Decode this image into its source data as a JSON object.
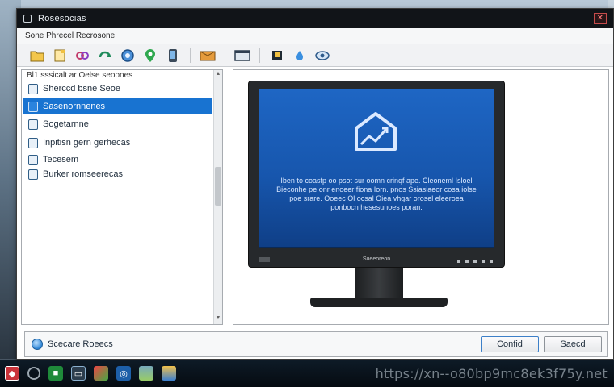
{
  "window": {
    "title": "Rosesocias",
    "close_glyph": "✕"
  },
  "menubar": {
    "label": "Sone Phrecel Recrosone"
  },
  "toolbar": {
    "icons": [
      "folder-icon",
      "document-icon",
      "link-icon",
      "refresh-icon",
      "globe-icon",
      "location-pin-icon",
      "phone-icon",
      "package-icon",
      "window-icon",
      "cube-icon",
      "droplet-icon",
      "eye-icon"
    ]
  },
  "left_pane": {
    "header": "Bl1 sssicalt ar Oelse seoones",
    "items": [
      {
        "label": "Sherccd bsne Seoe"
      },
      {
        "label": "Sasenornnenes"
      },
      {
        "label": "Sogetarnne"
      },
      {
        "label": "Inpitisn gern gerhecas"
      },
      {
        "label": "Tecesem"
      },
      {
        "label": "Burker romseerecas"
      }
    ],
    "selected_index": 1
  },
  "monitor": {
    "screen_text": "Iben to coasfp oo psot sur oomn crinqf ape. Cleoneml Isloel Bieconhe pe onr enoeer fiona Iorn. pnos Ssiasiaeor cosa iolse poe srare. Ooeec Ol ocsal Oiea vhgar orosel eleeroea ponbocn hesesunoes poran.",
    "brand": "Sueeoreon"
  },
  "footer": {
    "status_text": "Scecare Roeecs",
    "ok_label": "Confid",
    "cancel_label": "Saecd"
  },
  "taskbar": {
    "items": [
      "shield-icon",
      "circle-icon",
      "green-app-icon",
      "monitor-app-icon",
      "photos-icon",
      "network-icon",
      "gallery-icon",
      "folder-app-icon"
    ]
  },
  "watermark": "https://xn--o80bp9mc8ek3f75y.net"
}
